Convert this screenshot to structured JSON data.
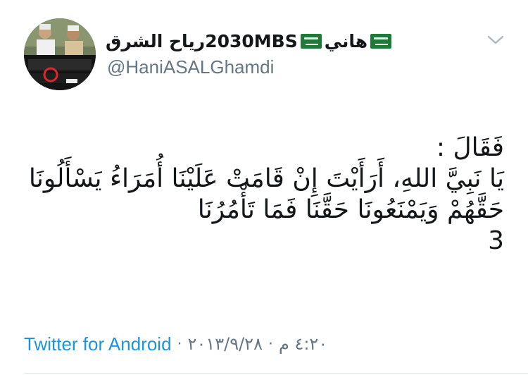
{
  "user": {
    "display_name_part1": "رياح الشرق",
    "display_name_part2": "2030MBS",
    "display_name_part3": "هاني",
    "handle": "@HaniASALGhamdi"
  },
  "icons": {
    "flag": "saudi-flag-icon",
    "menu": "chevron-down-icon",
    "avatar": "profile-photo"
  },
  "tweet": {
    "lines": [
      "فَقَالَ :",
      "يَا نَبِيَّ اللهِ، أَرَأَيْتَ إِنْ قَامَتْ عَلَيْنَا أُمَرَاءُ يَسْأَلُونَا",
      "حَقَّهُمْ وَيَمْنَعُونَا حَقَّنَا فَمَا تَأْمُرُنَا",
      "3"
    ]
  },
  "footer": {
    "source": "Twitter for Android",
    "separator": "·",
    "date": "٢٠١٣/٩/٢٨",
    "time": "٤:٢٠ م"
  },
  "colors": {
    "text": "#14171a",
    "secondary": "#657786",
    "link": "#1b95e0",
    "flag_green": "#1f7a3a",
    "divider": "#e1e8ed"
  }
}
